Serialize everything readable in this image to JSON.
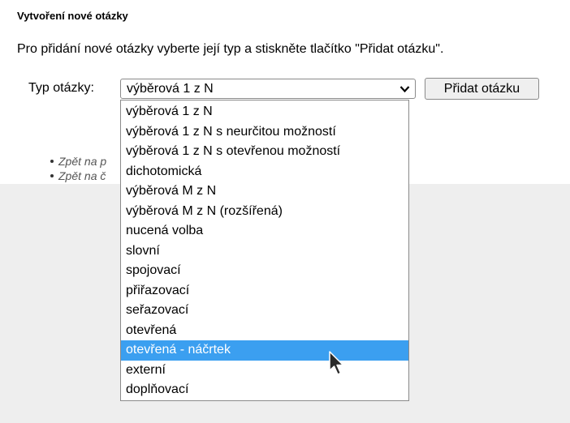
{
  "page": {
    "title": "Vytvoření nové otázky",
    "intro": "Pro přidání nové otázky vyberte její typ a stiskněte tlačítko \"Přidat otázku\"."
  },
  "form": {
    "type_label": "Typ otázky:",
    "selected_type": "výběrová 1 z N",
    "add_button_label": "Přidat otázku"
  },
  "dropdown": {
    "highlighted_index": 12,
    "options": [
      "výběrová 1 z N",
      "výběrová 1 z N s neurčitou možností",
      "výběrová 1 z N s otevřenou možností",
      "dichotomická",
      "výběrová M z N",
      "výběrová M z N (rozšířená)",
      "nucená volba",
      "slovní",
      "spojovací",
      "přiřazovací",
      "seřazovací",
      "otevřená",
      "otevřená - náčrtek",
      "externí",
      "doplňovací"
    ]
  },
  "links": [
    "Zpět na p",
    "Zpět na č"
  ],
  "colors": {
    "highlight": "#3b9ff0",
    "gray_band": "#eeeeee",
    "link_text": "#555555"
  },
  "icons": {
    "select_chevron": "chevron-down-icon",
    "cursor": "mouse-pointer-icon"
  }
}
